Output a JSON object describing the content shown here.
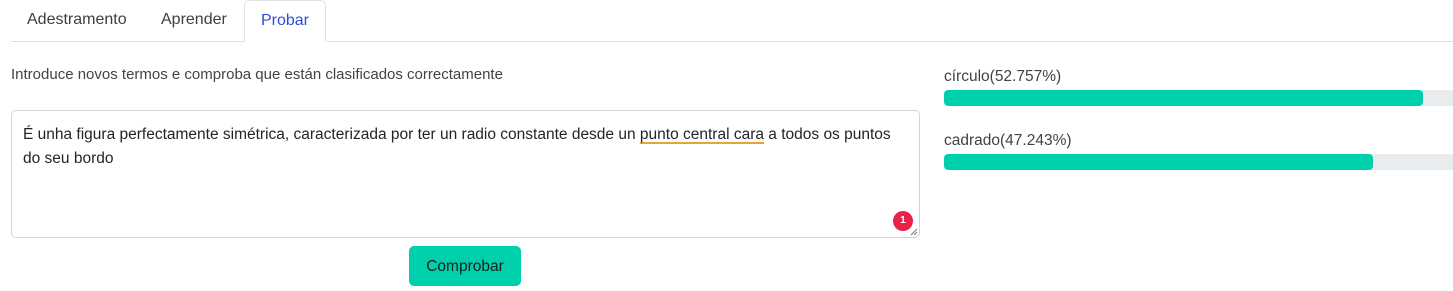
{
  "tabs": [
    {
      "label": "Adestramento",
      "active": false
    },
    {
      "label": "Aprender",
      "active": false
    },
    {
      "label": "Probar",
      "active": true
    }
  ],
  "intro_text": "Introduce novos termos e comproba que están clasificados correctamente",
  "input": {
    "text_before": "É unha figura perfectamente simétrica, caracterizada por ter un radio constante desde un ",
    "text_flagged": "punto central cara",
    "text_after": " a todos os puntos do seu bordo",
    "issue_count": "1"
  },
  "check_button_label": "Comprobar",
  "results": [
    {
      "label": "círculo(52.757%)",
      "fraction": 0.9415
    },
    {
      "label": "cadrado(47.243%)",
      "fraction": 0.8428
    }
  ],
  "colors": {
    "accent": "#00cfac",
    "active_tab": "#2b4fd8",
    "badge": "#e8234a",
    "spellcheck_underline": "#e8a33d"
  }
}
